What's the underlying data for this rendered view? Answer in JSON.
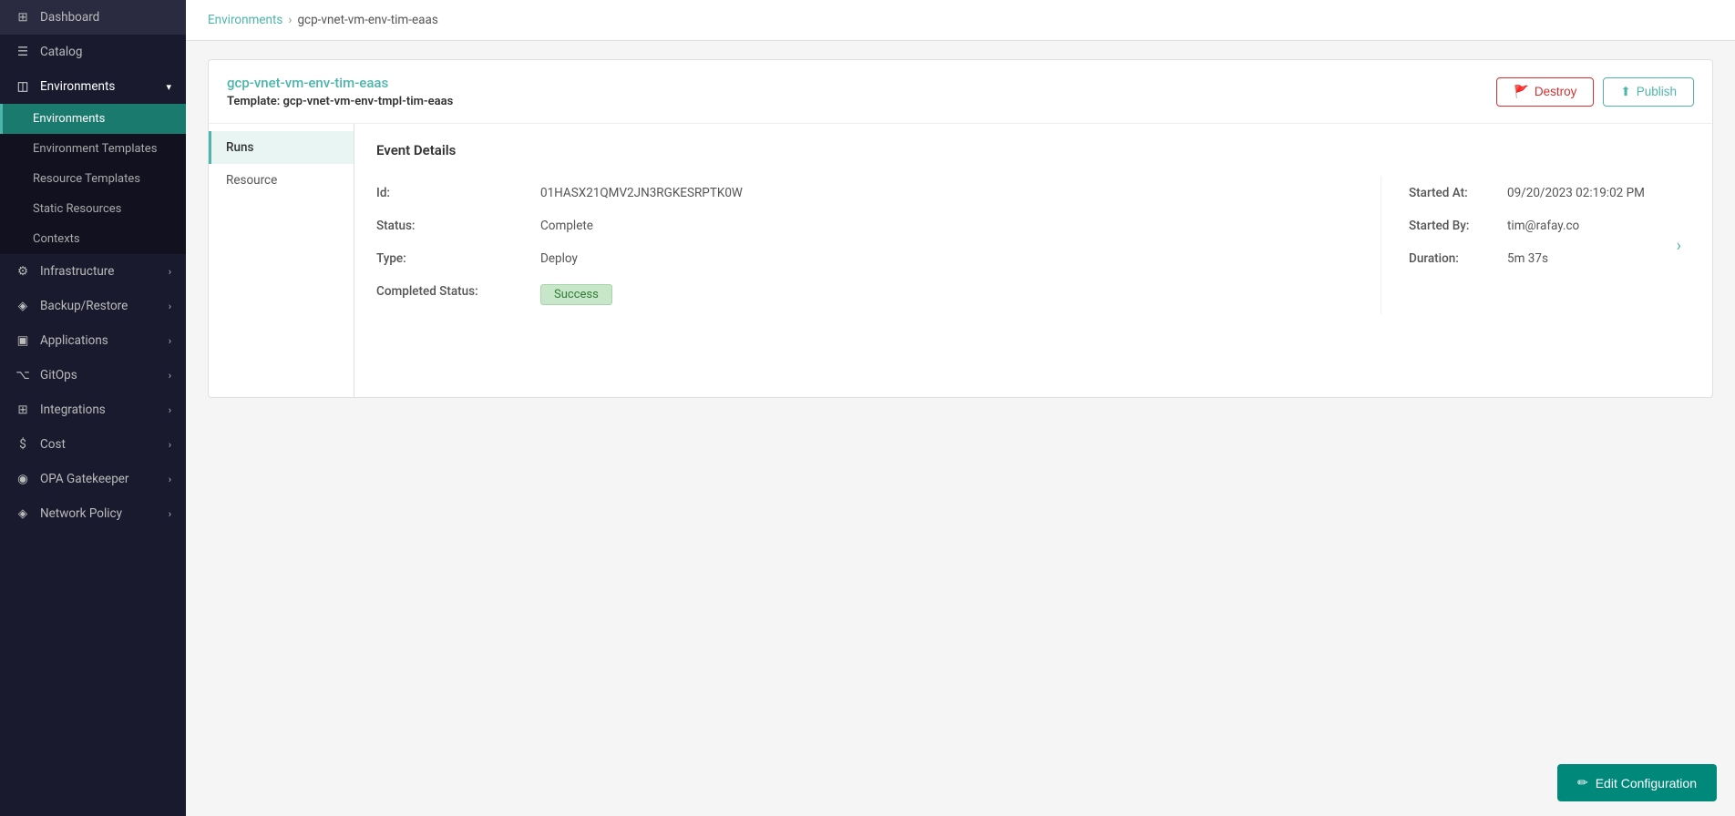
{
  "sidebar": {
    "items": [
      {
        "id": "dashboard",
        "label": "Dashboard",
        "icon": "⊞",
        "hasChildren": false
      },
      {
        "id": "catalog",
        "label": "Catalog",
        "icon": "☰",
        "hasChildren": false
      },
      {
        "id": "environments",
        "label": "Environments",
        "icon": "◫",
        "hasChildren": true,
        "expanded": true
      },
      {
        "id": "infrastructure",
        "label": "Infrastructure",
        "icon": "⚙",
        "hasChildren": true
      },
      {
        "id": "backup-restore",
        "label": "Backup/Restore",
        "icon": "◈",
        "hasChildren": true
      },
      {
        "id": "applications",
        "label": "Applications",
        "icon": "▣",
        "hasChildren": true
      },
      {
        "id": "gitops",
        "label": "GitOps",
        "icon": "⌥",
        "hasChildren": true
      },
      {
        "id": "integrations",
        "label": "Integrations",
        "icon": "⊞",
        "hasChildren": true
      },
      {
        "id": "cost",
        "label": "Cost",
        "icon": "$",
        "hasChildren": true
      },
      {
        "id": "opa-gatekeeper",
        "label": "OPA Gatekeeper",
        "icon": "◉",
        "hasChildren": true
      },
      {
        "id": "network-policy",
        "label": "Network Policy",
        "icon": "◈",
        "hasChildren": true
      }
    ],
    "environments_sub": [
      {
        "id": "environments",
        "label": "Environments",
        "active": true
      },
      {
        "id": "environment-templates",
        "label": "Environment Templates"
      },
      {
        "id": "resource-templates",
        "label": "Resource Templates"
      },
      {
        "id": "static-resources",
        "label": "Static Resources"
      },
      {
        "id": "contexts",
        "label": "Contexts"
      }
    ]
  },
  "breadcrumb": {
    "link_label": "Environments",
    "separator": "›",
    "current": "gcp-vnet-vm-env-tim-eaas"
  },
  "card": {
    "title": "gcp-vnet-vm-env-tim-eaas",
    "template_label": "Template:",
    "template_value": "gcp-vnet-vm-env-tmpl-tim-eaas",
    "destroy_label": "Destroy",
    "publish_label": "Publish"
  },
  "tabs": [
    {
      "id": "runs",
      "label": "Runs",
      "active": true
    },
    {
      "id": "resource",
      "label": "Resource",
      "active": false
    }
  ],
  "event_details": {
    "title": "Event Details",
    "id_label": "Id:",
    "id_value": "01HASX21QMV2JN3RGKESRPTK0W",
    "status_label": "Status:",
    "status_value": "Complete",
    "type_label": "Type:",
    "type_value": "Deploy",
    "completed_status_label": "Completed Status:",
    "completed_status_value": "Success",
    "started_at_label": "Started At:",
    "started_at_value": "09/20/2023 02:19:02 PM",
    "started_by_label": "Started By:",
    "started_by_value": "tim@rafay.co",
    "duration_label": "Duration:",
    "duration_value": "5m 37s"
  },
  "bottom_bar": {
    "edit_config_label": "Edit Configuration"
  }
}
